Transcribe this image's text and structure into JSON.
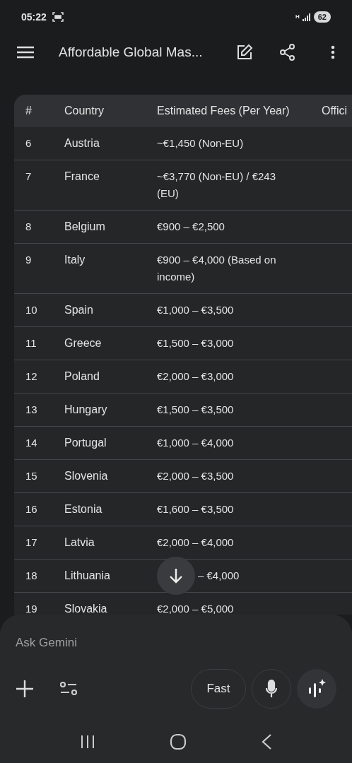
{
  "status_bar": {
    "time": "05:22",
    "network": "H",
    "battery": "62"
  },
  "toolbar": {
    "title": "Affordable Global Mas..."
  },
  "table": {
    "columns": [
      "#",
      "Country",
      "Estimated Fees (Per Year)",
      "Offici"
    ],
    "rows": [
      {
        "num": "6",
        "country": "Austria",
        "fees": "~€1,450 (Non-EU)"
      },
      {
        "num": "7",
        "country": "France",
        "fees": "~€3,770 (Non-EU) / €243 (EU)"
      },
      {
        "num": "8",
        "country": "Belgium",
        "fees": "€900 – €2,500"
      },
      {
        "num": "9",
        "country": "Italy",
        "fees": "€900 – €4,000 (Based on income)"
      },
      {
        "num": "10",
        "country": "Spain",
        "fees": "€1,000 – €3,500"
      },
      {
        "num": "11",
        "country": "Greece",
        "fees": "€1,500 – €3,000"
      },
      {
        "num": "12",
        "country": "Poland",
        "fees": "€2,000 – €3,000"
      },
      {
        "num": "13",
        "country": "Hungary",
        "fees": "€1,500 – €3,500"
      },
      {
        "num": "14",
        "country": "Portugal",
        "fees": "€1,000 – €4,000"
      },
      {
        "num": "15",
        "country": "Slovenia",
        "fees": "€2,000 – €3,500"
      },
      {
        "num": "16",
        "country": "Estonia",
        "fees": "€1,600 – €3,500"
      },
      {
        "num": "17",
        "country": "Latvia",
        "fees": "€2,000 – €4,000"
      },
      {
        "num": "18",
        "country": "Lithuania",
        "fees": "– €4,000",
        "covered": true
      },
      {
        "num": "19",
        "country": "Slovakia",
        "fees": "€2,000 – €5,000"
      }
    ]
  },
  "composer": {
    "placeholder": "Ask Gemini",
    "mode_button": "Fast"
  }
}
